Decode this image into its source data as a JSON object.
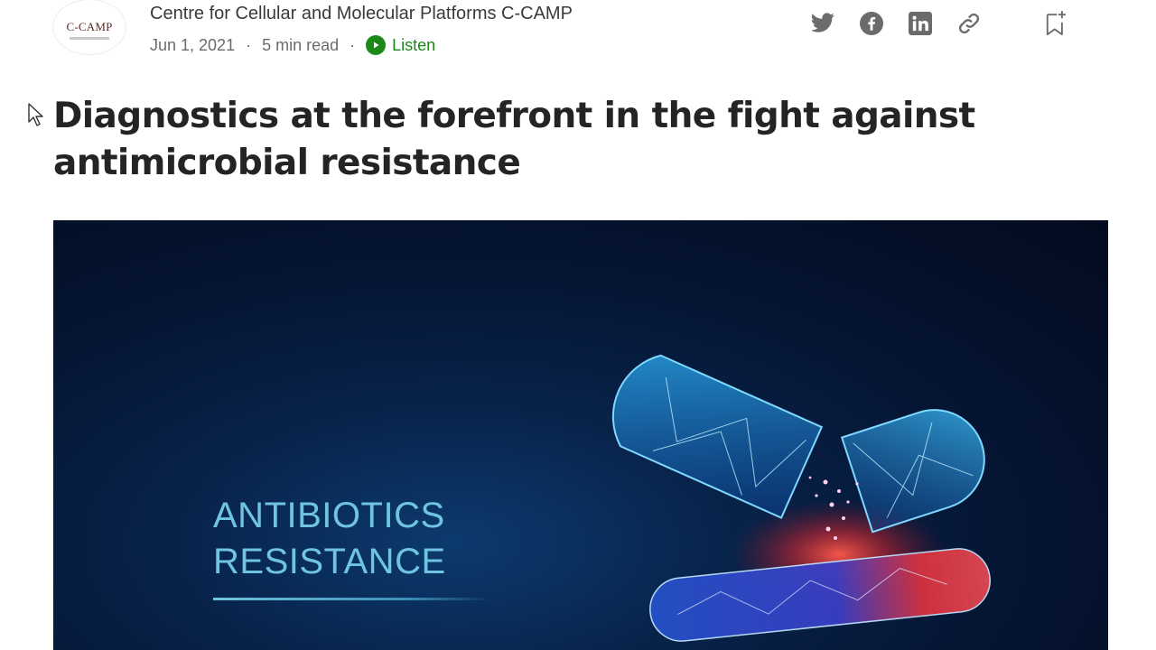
{
  "author": {
    "name": "Centre for Cellular and Molecular Platforms C-CAMP",
    "avatar_logo_text": "C-CAMP"
  },
  "meta": {
    "date": "Jun 1, 2021",
    "separator": "·",
    "read_time": "5 min read",
    "listen_label": "Listen"
  },
  "share": {
    "icons": [
      "twitter-icon",
      "facebook-icon",
      "linkedin-icon",
      "link-icon"
    ],
    "bookmark_icon": "bookmark-add-icon"
  },
  "article": {
    "title": "Diagnostics at the forefront in the fight against antimicrobial resistance"
  },
  "hero_image": {
    "line1": "ANTIBIOTICS",
    "line2": "RESISTANCE"
  },
  "colors": {
    "accent_green": "#1a8917",
    "text_primary": "#242424",
    "text_secondary": "#6b6b6b",
    "icon_gray": "#6b6b6b",
    "hero_text": "#6fc4df"
  }
}
